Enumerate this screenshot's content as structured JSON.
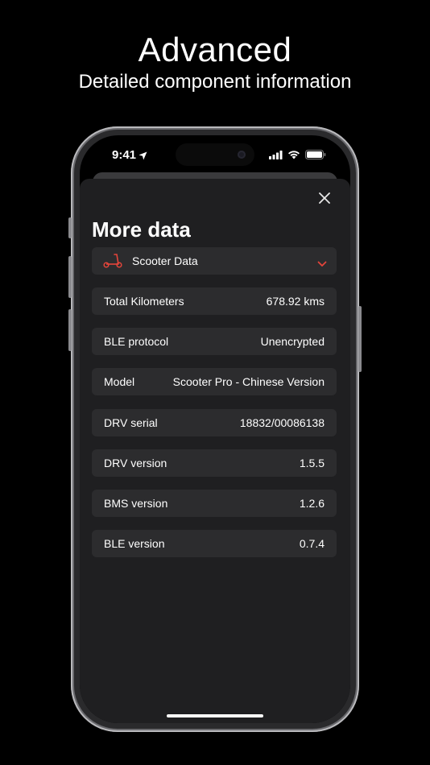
{
  "promo": {
    "title": "Advanced",
    "subtitle": "Detailed component information"
  },
  "status_bar": {
    "time": "9:41",
    "icons": [
      "location-arrow-icon",
      "signal-icon",
      "wifi-icon",
      "battery-icon"
    ]
  },
  "sheet": {
    "title": "More data",
    "close_icon": "close-icon",
    "selector": {
      "icon": "scooter-icon",
      "label": "Scooter Data",
      "chevron": "chevron-down-icon"
    },
    "rows": [
      {
        "label": "Total Kilometers",
        "value": "678.92 kms"
      },
      {
        "label": "BLE protocol",
        "value": "Unencrypted"
      },
      {
        "label": "Model",
        "value": "Scooter Pro - Chinese Version"
      },
      {
        "label": "DRV serial",
        "value": "18832/00086138"
      },
      {
        "label": "DRV version",
        "value": "1.5.5"
      },
      {
        "label": "BMS version",
        "value": "1.2.6"
      },
      {
        "label": "BLE version",
        "value": "0.7.4"
      }
    ]
  },
  "colors": {
    "accent": "#e5453b",
    "sheet_background": "#1f1f21",
    "row_background": "#2c2c2e"
  }
}
